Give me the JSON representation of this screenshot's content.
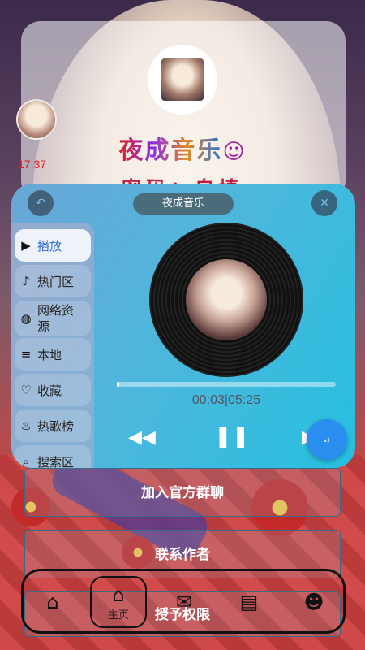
{
  "app": {
    "title": "夜成音乐",
    "subtitle": "密码：自填",
    "time": "17:37"
  },
  "player": {
    "title": "夜成音乐",
    "current_time": "00:03",
    "duration": "05:25",
    "progress": 0.01
  },
  "menu": {
    "items": [
      {
        "label": "播放",
        "icon": "play-icon",
        "active": true
      },
      {
        "label": "热门区",
        "icon": "music-note-icon"
      },
      {
        "label": "网络资源",
        "icon": "globe-icon"
      },
      {
        "label": "本地",
        "icon": "list-icon"
      },
      {
        "label": "收藏",
        "icon": "heart-icon"
      },
      {
        "label": "热歌榜",
        "icon": "fire-icon"
      },
      {
        "label": "搜索区",
        "icon": "search-icon"
      }
    ]
  },
  "actions": {
    "join_group": "加入官方群聊",
    "contact_author": "联系作者",
    "grant_permission": "授予权限"
  },
  "nav": {
    "home_label": "主页"
  },
  "colors": {
    "accent": "#2a8df0",
    "title_red": "#e02020"
  }
}
